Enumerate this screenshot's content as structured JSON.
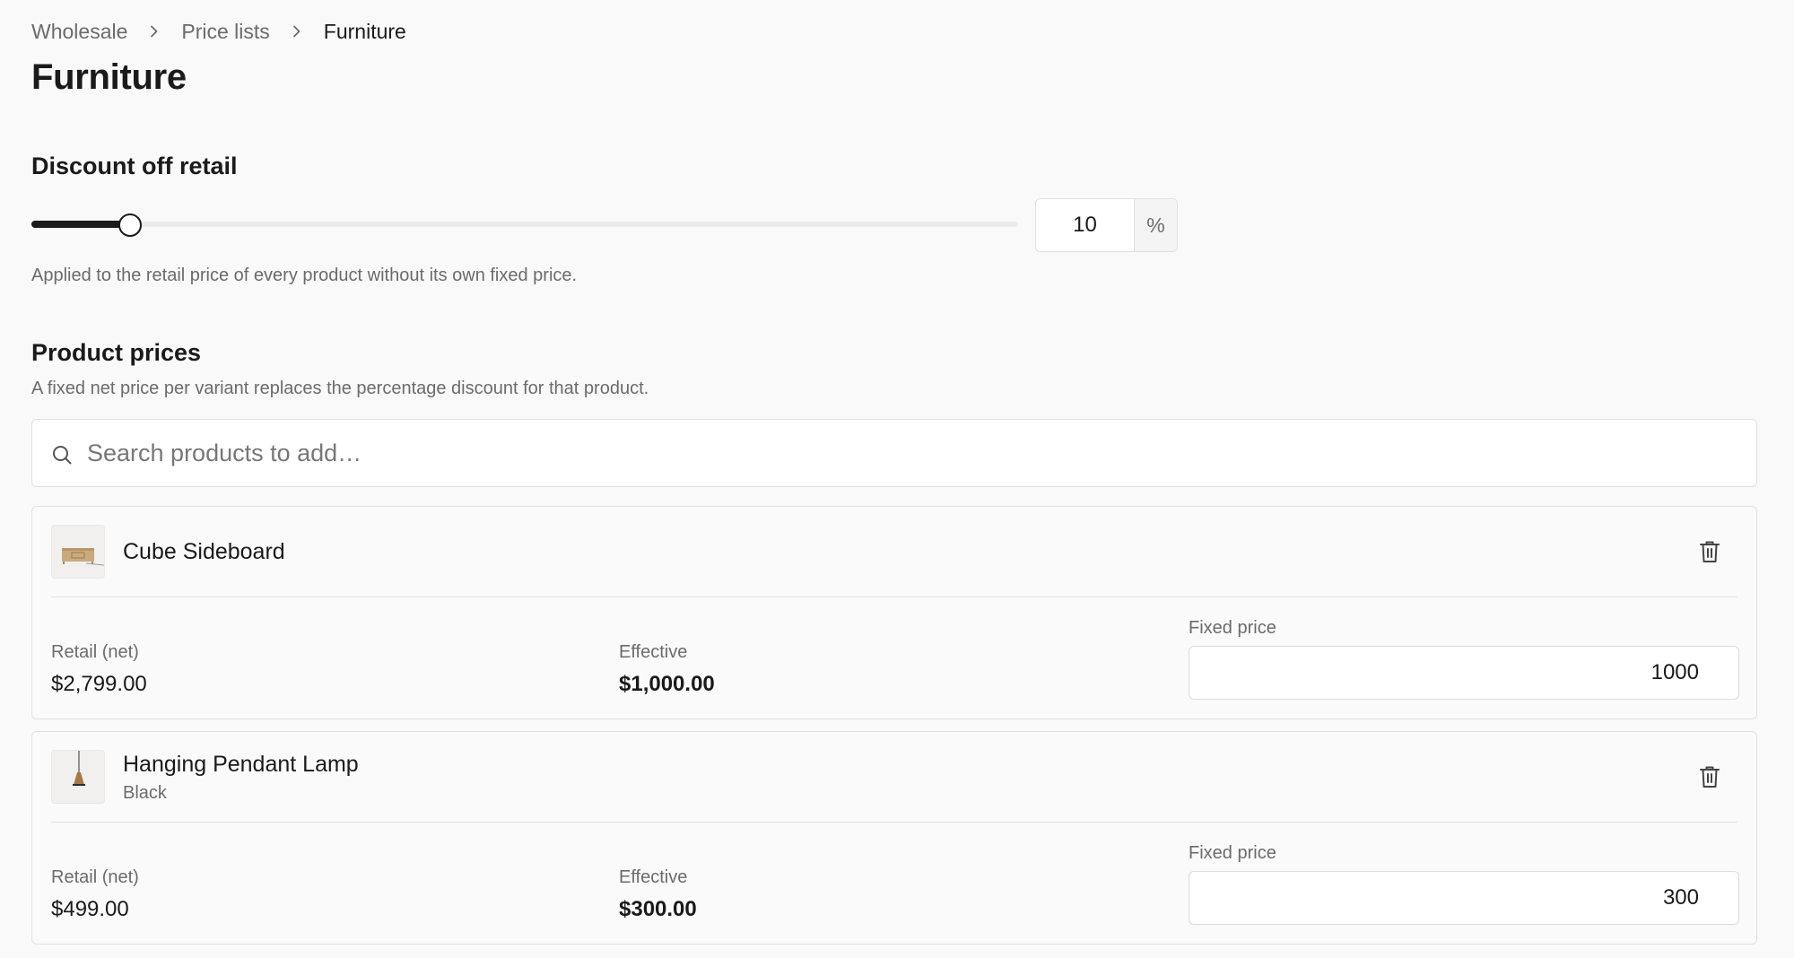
{
  "breadcrumb": {
    "items": [
      "Wholesale",
      "Price lists",
      "Furniture"
    ]
  },
  "page_title": "Furniture",
  "discount": {
    "title": "Discount off retail",
    "value": "10",
    "suffix": "%",
    "slider_fraction": 0.1,
    "help": "Applied to the retail price of every product without its own fixed price."
  },
  "product_prices": {
    "title": "Product prices",
    "help": "A fixed net price per variant replaces the percentage discount for that product.",
    "search_placeholder": "Search products to add…",
    "products": [
      {
        "name": "Cube Sideboard",
        "variant": "",
        "thumb_icon": "sideboard-thumbnail",
        "retail_label": "Retail (net)",
        "retail_value": "$2,799.00",
        "effective_label": "Effective",
        "effective_value": "$1,000.00",
        "fixed_label": "Fixed price",
        "fixed_value": "1000"
      },
      {
        "name": "Hanging Pendant Lamp",
        "variant": "Black",
        "thumb_icon": "pendant-lamp-thumbnail",
        "retail_label": "Retail (net)",
        "retail_value": "$499.00",
        "effective_label": "Effective",
        "effective_value": "$300.00",
        "fixed_label": "Fixed price",
        "fixed_value": "300"
      }
    ]
  },
  "colors": {
    "background": "#f9f9f9",
    "text": "#1a1a1a",
    "muted": "#6b6b6b",
    "border": "#e1e1e1",
    "accent": "#1a1a1a"
  }
}
